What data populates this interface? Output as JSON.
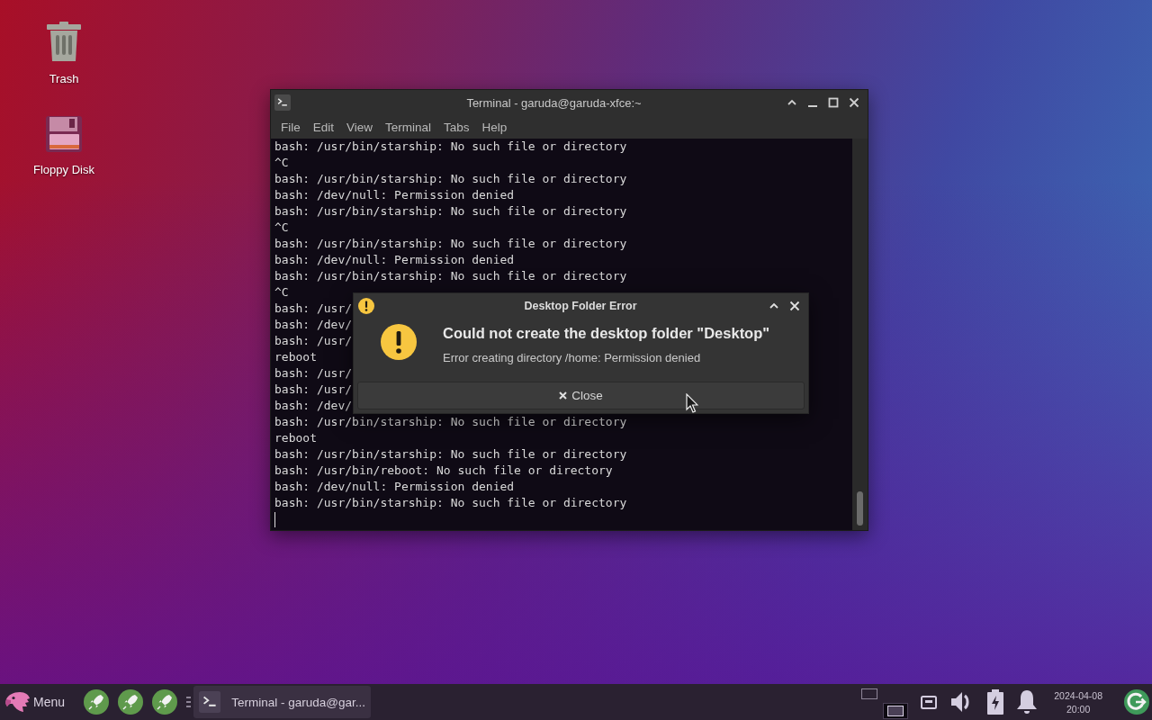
{
  "desktop_icons": [
    {
      "kind": "trash",
      "label": "Trash"
    },
    {
      "kind": "floppy",
      "label": "Floppy Disk"
    }
  ],
  "terminal": {
    "title": "Terminal - garuda@garuda-xfce:~",
    "menu": [
      "File",
      "Edit",
      "View",
      "Terminal",
      "Tabs",
      "Help"
    ],
    "lines": [
      "bash: /usr/bin/starship: No such file or directory",
      "^C",
      "bash: /usr/bin/starship: No such file or directory",
      "bash: /dev/null: Permission denied",
      "bash: /usr/bin/starship: No such file or directory",
      "^C",
      "bash: /usr/bin/starship: No such file or directory",
      "bash: /dev/null: Permission denied",
      "bash: /usr/bin/starship: No such file or directory",
      "^C",
      "bash: /usr/",
      "bash: /dev/",
      "bash: /usr/",
      "reboot",
      "bash: /usr/",
      "bash: /usr/",
      "bash: /dev/",
      "bash: /usr/bin/starship: No such file or directory",
      "reboot",
      "bash: /usr/bin/starship: No such file or directory",
      "bash: /usr/bin/reboot: No such file or directory",
      "bash: /dev/null: Permission denied",
      "bash: /usr/bin/starship: No such file or directory"
    ]
  },
  "dialog": {
    "title": "Desktop Folder Error",
    "heading": "Could not create the desktop folder \"Desktop\"",
    "message": "Error creating directory /home: Permission denied",
    "button": "Close"
  },
  "taskbar": {
    "menu_label": "Menu",
    "tasks": [
      {
        "label": "Terminal - garuda@gar...",
        "selected": true
      }
    ],
    "workspaces": [
      {
        "selected": false
      },
      {
        "selected": true
      }
    ],
    "clock": {
      "date": "2024-04-08",
      "time": "20:00"
    }
  }
}
